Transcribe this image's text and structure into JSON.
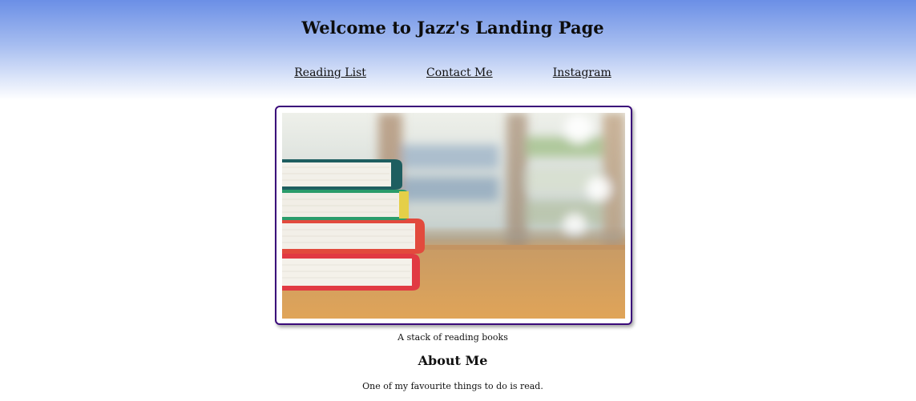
{
  "header": {
    "title": "Welcome to Jazz's Landing Page",
    "nav": [
      {
        "label": "Reading List"
      },
      {
        "label": "Contact Me"
      },
      {
        "label": "Instagram"
      }
    ]
  },
  "hero": {
    "image_name": "books-stack-photo",
    "caption": "A stack of reading books"
  },
  "about": {
    "title": "About Me",
    "text": "One of my favourite things to do is read."
  },
  "colors": {
    "header_gradient_top": "#6b8fe6",
    "frame_border": "#3a0a7a"
  }
}
